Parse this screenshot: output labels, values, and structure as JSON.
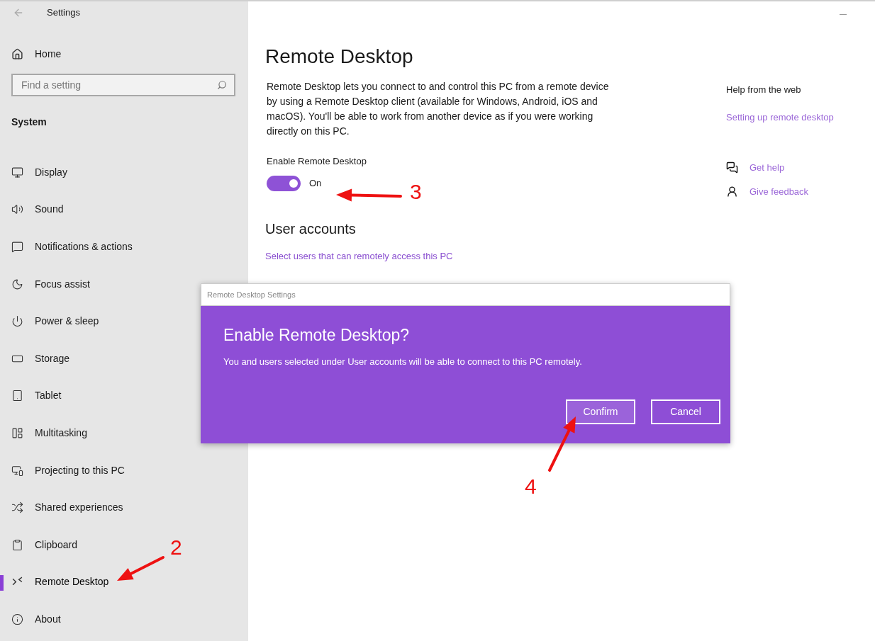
{
  "window": {
    "title": "Settings"
  },
  "sidebar": {
    "home": "Home",
    "search": {
      "placeholder": "Find a setting"
    },
    "section": "System",
    "items": [
      {
        "label": "Display",
        "selected": false
      },
      {
        "label": "Sound",
        "selected": false
      },
      {
        "label": "Notifications & actions",
        "selected": false
      },
      {
        "label": "Focus assist",
        "selected": false
      },
      {
        "label": "Power & sleep",
        "selected": false
      },
      {
        "label": "Storage",
        "selected": false
      },
      {
        "label": "Tablet",
        "selected": false
      },
      {
        "label": "Multitasking",
        "selected": false
      },
      {
        "label": "Projecting to this PC",
        "selected": false
      },
      {
        "label": "Shared experiences",
        "selected": false
      },
      {
        "label": "Clipboard",
        "selected": false
      },
      {
        "label": "Remote Desktop",
        "selected": true
      },
      {
        "label": "About",
        "selected": false
      }
    ]
  },
  "page": {
    "title": "Remote Desktop",
    "description": "Remote Desktop lets you connect to and control this PC from a remote device by using a Remote Desktop client (available for Windows, Android, iOS and macOS). You'll be able to work from another device as if you were working directly on this PC.",
    "enable": {
      "label": "Enable Remote Desktop",
      "on": true,
      "state": "On"
    },
    "user_accounts": {
      "title": "User accounts",
      "link": "Select users that can remotely access this PC"
    }
  },
  "help": {
    "title": "Help from the web",
    "link": "Setting up remote desktop",
    "actions": [
      "Get help",
      "Give feedback"
    ]
  },
  "dialog": {
    "title": "Remote Desktop Settings",
    "heading": "Enable Remote Desktop?",
    "message": "You and users selected under User accounts will be able to connect to this PC remotely.",
    "buttons": [
      {
        "label": "Confirm",
        "selected": true
      },
      {
        "label": "Cancel",
        "selected": false
      }
    ]
  },
  "annotations": [
    {
      "label": "2"
    },
    {
      "label": "3"
    },
    {
      "label": "4"
    }
  ]
}
